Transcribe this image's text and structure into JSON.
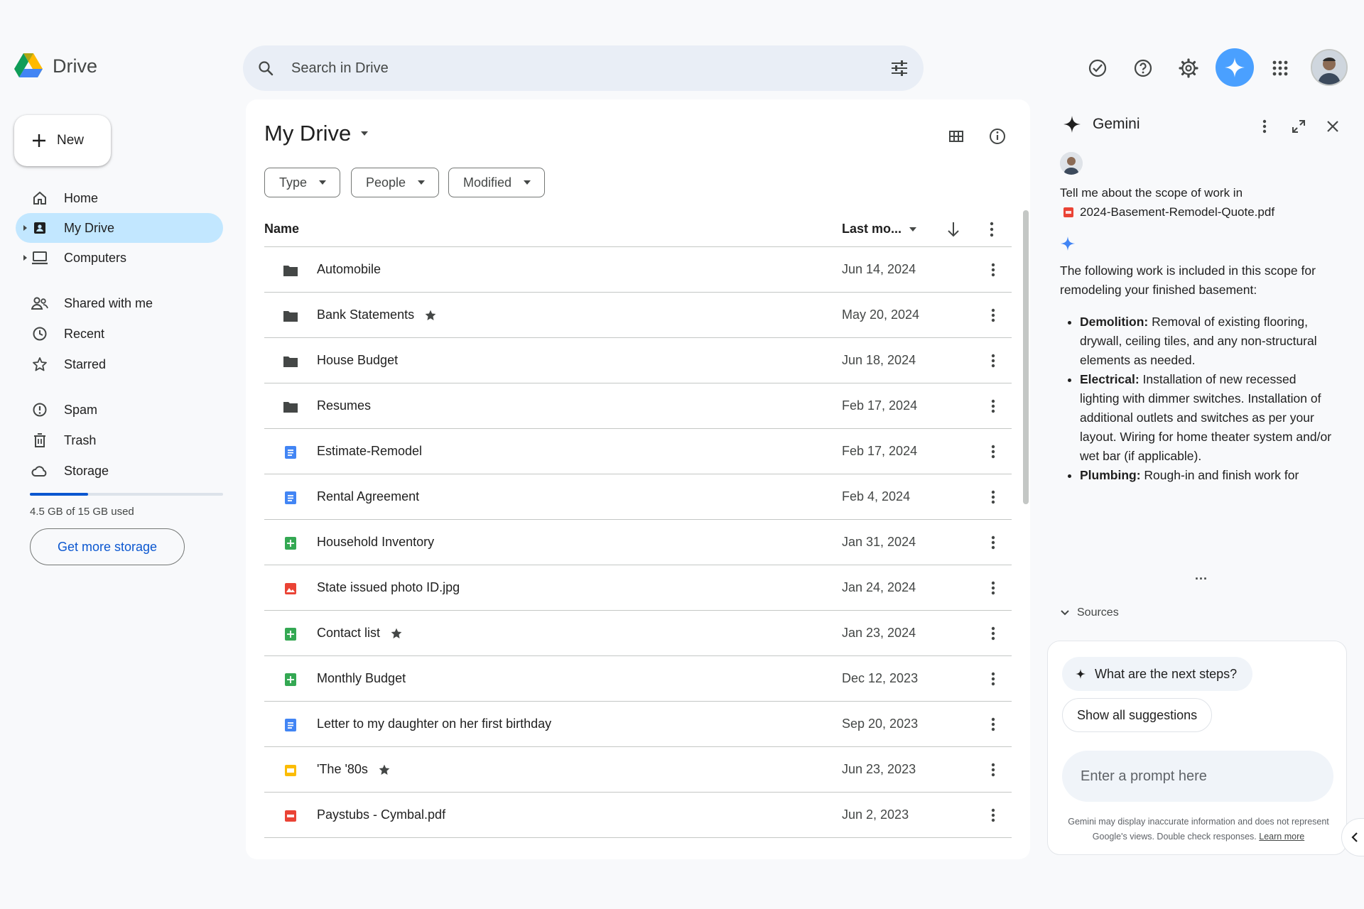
{
  "app": {
    "title": "Drive"
  },
  "search": {
    "placeholder": "Search in Drive"
  },
  "sidebar": {
    "new_label": "New",
    "items": [
      {
        "label": "Home",
        "icon": "home-icon"
      },
      {
        "label": "My Drive",
        "icon": "my-drive-icon",
        "active": true
      },
      {
        "label": "Computers",
        "icon": "computer-icon"
      },
      {
        "label": "Shared with me",
        "icon": "people-icon"
      },
      {
        "label": "Recent",
        "icon": "clock-icon"
      },
      {
        "label": "Starred",
        "icon": "star-icon"
      },
      {
        "label": "Spam",
        "icon": "spam-icon"
      },
      {
        "label": "Trash",
        "icon": "trash-icon"
      },
      {
        "label": "Storage",
        "icon": "cloud-icon"
      }
    ],
    "storage_text": "4.5 GB of 15 GB used",
    "storage_fraction": 0.3,
    "get_storage_label": "Get more storage"
  },
  "main": {
    "title": "My Drive",
    "filters": [
      "Type",
      "People",
      "Modified"
    ],
    "columns": {
      "name": "Name",
      "modified": "Last mo..."
    },
    "files": [
      {
        "name": "Automobile",
        "type": "folder",
        "date": "Jun 14, 2024",
        "starred": false
      },
      {
        "name": "Bank Statements",
        "type": "folder",
        "date": "May 20, 2024",
        "starred": true
      },
      {
        "name": "House Budget",
        "type": "folder",
        "date": "Jun 18, 2024",
        "starred": false
      },
      {
        "name": "Resumes",
        "type": "folder",
        "date": "Feb 17, 2024",
        "starred": false
      },
      {
        "name": "Estimate-Remodel",
        "type": "doc",
        "date": "Feb 17, 2024",
        "starred": false
      },
      {
        "name": "Rental Agreement",
        "type": "doc",
        "date": "Feb 4, 2024",
        "starred": false
      },
      {
        "name": "Household Inventory",
        "type": "sheet",
        "date": "Jan 31, 2024",
        "starred": false
      },
      {
        "name": "State issued photo ID.jpg",
        "type": "image",
        "date": "Jan 24, 2024",
        "starred": false
      },
      {
        "name": "Contact list",
        "type": "sheet",
        "date": "Jan 23, 2024",
        "starred": true
      },
      {
        "name": "Monthly Budget",
        "type": "sheet",
        "date": "Dec 12, 2023",
        "starred": false
      },
      {
        "name": "Letter to my daughter on her first birthday",
        "type": "doc",
        "date": "Sep 20, 2023",
        "starred": false
      },
      {
        "name": "'The '80s",
        "type": "slides",
        "date": "Jun 23, 2023",
        "starred": true
      },
      {
        "name": "Paystubs - Cymbal.pdf",
        "type": "pdf",
        "date": "Jun 2, 2023",
        "starred": false
      }
    ]
  },
  "gemini": {
    "title": "Gemini",
    "question": "Tell me about the scope of work in",
    "file": "2024-Basement-Remodel-Quote.pdf",
    "answer_intro": "The following work is included in this scope for remodeling your finished basement:",
    "bullets": [
      {
        "title": "Demolition:",
        "text": "Removal of existing flooring, drywall, ceiling tiles, and any non-structural elements as needed."
      },
      {
        "title": "Electrical:",
        "text": "Installation of new recessed lighting with dimmer switches. Installation of additional outlets and switches as per your layout. Wiring for home theater system and/or wet bar (if applicable)."
      },
      {
        "title": "Plumbing:",
        "text": "Rough-in and finish work for"
      }
    ],
    "ellipsis": "...",
    "sources_label": "Sources",
    "suggestion": "What are the next steps?",
    "show_all": "Show all suggestions",
    "prompt_placeholder": "Enter a prompt here",
    "disclaimer": "Gemini may display inaccurate information and does not represent Google's views. Double check responses.",
    "learn_more": "Learn more"
  },
  "colors": {
    "accent": "#0b57d0",
    "active_nav": "#c2e7ff",
    "gemini_button": "#4aa0ff",
    "folder": "#444746",
    "doc": "#4285f4",
    "sheet": "#34a853",
    "slides": "#fbbc04",
    "pdf": "#ea4335"
  }
}
